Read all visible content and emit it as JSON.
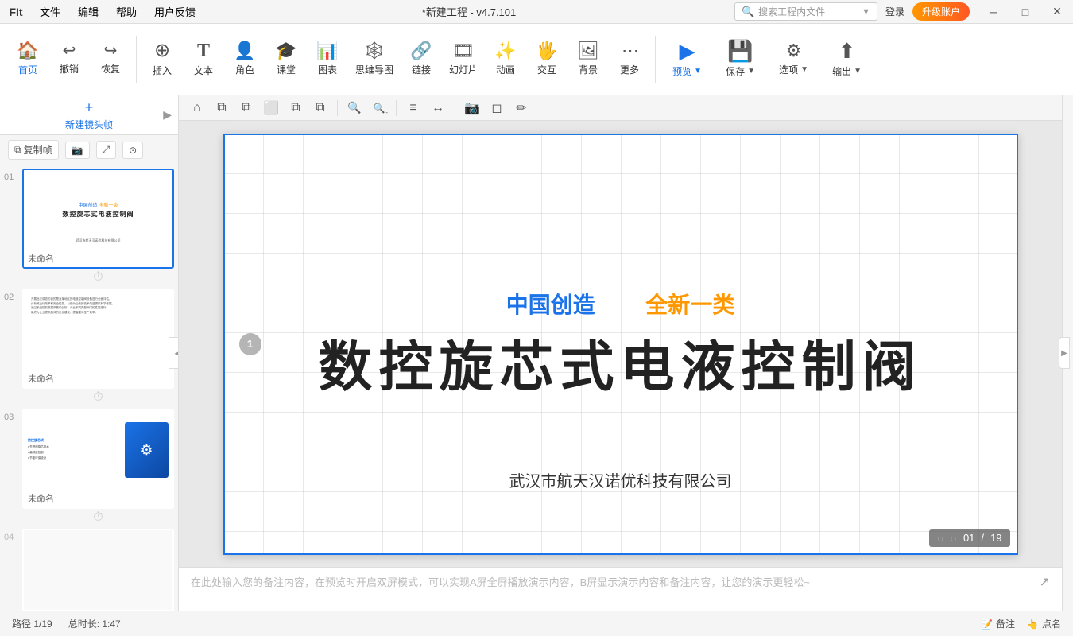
{
  "app": {
    "logo": "FIt",
    "title": "*新建工程 - v4.7.101",
    "search_placeholder": "搜索工程内文件",
    "login": "登录",
    "upgrade": "升级账户"
  },
  "menu": {
    "items": [
      "文件",
      "编辑",
      "帮助",
      "用户反馈"
    ]
  },
  "toolbar": {
    "items": [
      {
        "id": "home",
        "icon": "🏠",
        "label": "首页"
      },
      {
        "id": "undo",
        "icon": "↩",
        "label": "撤销"
      },
      {
        "id": "redo",
        "icon": "↪",
        "label": "恢复"
      },
      {
        "id": "insert",
        "icon": "⊕",
        "label": "插入"
      },
      {
        "id": "text",
        "icon": "T",
        "label": "文本"
      },
      {
        "id": "role",
        "icon": "👤",
        "label": "角色"
      },
      {
        "id": "classroom",
        "icon": "🎓",
        "label": "课堂"
      },
      {
        "id": "chart",
        "icon": "📊",
        "label": "图表"
      },
      {
        "id": "mindmap",
        "icon": "🧠",
        "label": "思维导图"
      },
      {
        "id": "link",
        "icon": "🔗",
        "label": "链接"
      },
      {
        "id": "slides",
        "icon": "📽",
        "label": "幻灯片"
      },
      {
        "id": "animation",
        "icon": "⭐",
        "label": "动画"
      },
      {
        "id": "interact",
        "icon": "🖐",
        "label": "交互"
      },
      {
        "id": "background",
        "icon": "🖼",
        "label": "背景"
      },
      {
        "id": "more",
        "icon": "⋯",
        "label": "更多"
      },
      {
        "id": "preview",
        "icon": "▶",
        "label": "预览"
      },
      {
        "id": "save",
        "icon": "💾",
        "label": "保存"
      },
      {
        "id": "options",
        "icon": "⚙",
        "label": "选项"
      },
      {
        "id": "export",
        "icon": "⬆",
        "label": "输出"
      }
    ]
  },
  "canvas_toolbar": {
    "icons": [
      "⌂",
      "⧉",
      "⧉",
      "⬜",
      "⧉",
      "⧉",
      "🔍+",
      "🔍-",
      "≡",
      "↗",
      "↔",
      "⊡",
      "📷",
      "◻",
      "✏"
    ]
  },
  "slides": [
    {
      "number": "01",
      "label": "未命名",
      "active": true,
      "content_type": "title"
    },
    {
      "number": "02",
      "label": "未命名",
      "active": false,
      "content_type": "text"
    },
    {
      "number": "03",
      "label": "未命名",
      "active": false,
      "content_type": "image"
    },
    {
      "number": "04",
      "label": "",
      "active": false,
      "content_type": "empty"
    }
  ],
  "slide_actions": [
    {
      "id": "copy",
      "icon": "⧉",
      "label": "复制帧"
    },
    {
      "id": "camera",
      "icon": "📷",
      "label": ""
    },
    {
      "id": "expand",
      "icon": "⤢",
      "label": ""
    },
    {
      "id": "morph",
      "icon": "⊙",
      "label": ""
    }
  ],
  "new_slide": {
    "label": "新建镜头帧"
  },
  "main_slide": {
    "subtitle_blue": "中国创造",
    "subtitle_orange": "全新一类",
    "main_title": "数控旋芯式电液控制阀",
    "company": "武汉市航天汉诺优科技有限公司",
    "slide_number": "1"
  },
  "page_counter": {
    "current": "01",
    "total": "19",
    "separator": "/"
  },
  "notes_placeholder": "在此处输入您的备注内容，在预览时开启双屏模式，可以实现A屏全屏播放演示内容，B屏显示演示内容和备注内容，让您的演示更轻松~",
  "statusbar": {
    "page": "路径 1/19",
    "duration": "总时长: 1:47",
    "notes": "备注",
    "pointer": "点名"
  }
}
